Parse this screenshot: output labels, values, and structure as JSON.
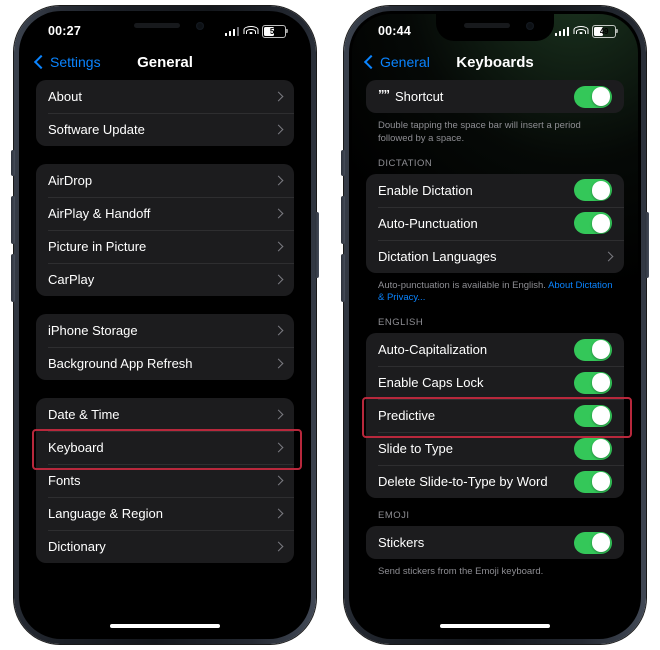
{
  "phones": [
    {
      "id": "left",
      "status": {
        "time": "00:27",
        "battery": "50",
        "wifi_icon": "wifi-icon",
        "cellular_icon": "cellular-signal-icon"
      },
      "nav": {
        "back_label": "Settings",
        "title": "General"
      },
      "groups": [
        {
          "rows": [
            {
              "label": "About",
              "type": "chevron"
            },
            {
              "label": "Software Update",
              "type": "chevron"
            }
          ]
        },
        {
          "rows": [
            {
              "label": "AirDrop",
              "type": "chevron"
            },
            {
              "label": "AirPlay & Handoff",
              "type": "chevron"
            },
            {
              "label": "Picture in Picture",
              "type": "chevron"
            },
            {
              "label": "CarPlay",
              "type": "chevron"
            }
          ]
        },
        {
          "rows": [
            {
              "label": "iPhone Storage",
              "type": "chevron"
            },
            {
              "label": "Background App Refresh",
              "type": "chevron"
            }
          ]
        },
        {
          "rows": [
            {
              "label": "Date & Time",
              "type": "chevron"
            },
            {
              "label": "Keyboard",
              "type": "chevron",
              "highlighted": true
            },
            {
              "label": "Fonts",
              "type": "chevron"
            },
            {
              "label": "Language & Region",
              "type": "chevron"
            },
            {
              "label": "Dictionary",
              "type": "chevron"
            }
          ]
        }
      ]
    },
    {
      "id": "right",
      "status": {
        "time": "00:44",
        "battery": "49",
        "wifi_icon": "wifi-icon",
        "cellular_icon": "cellular-signal-icon"
      },
      "nav": {
        "back_label": "General",
        "title": "Keyboards"
      },
      "groups": [
        {
          "rows": [
            {
              "label": "Shortcut",
              "type": "toggle",
              "toggle_on": true,
              "icon": "quote-shortcut-icon",
              "icon_glyph": "””"
            }
          ],
          "footnote": "Double tapping the space bar will insert a period followed by a space."
        },
        {
          "header": "DICTATION",
          "rows": [
            {
              "label": "Enable Dictation",
              "type": "toggle",
              "toggle_on": true
            },
            {
              "label": "Auto-Punctuation",
              "type": "toggle",
              "toggle_on": true
            },
            {
              "label": "Dictation Languages",
              "type": "chevron"
            }
          ],
          "footnote": "Auto-punctuation is available in English. ",
          "footnote_link": "About Dictation & Privacy..."
        },
        {
          "header": "ENGLISH",
          "rows": [
            {
              "label": "Auto-Capitalization",
              "type": "toggle",
              "toggle_on": true
            },
            {
              "label": "Enable Caps Lock",
              "type": "toggle",
              "toggle_on": true
            },
            {
              "label": "Predictive",
              "type": "toggle",
              "toggle_on": true,
              "highlighted": true
            },
            {
              "label": "Slide to Type",
              "type": "toggle",
              "toggle_on": true
            },
            {
              "label": "Delete Slide-to-Type by Word",
              "type": "toggle",
              "toggle_on": true
            }
          ]
        },
        {
          "header": "EMOJI",
          "rows": [
            {
              "label": "Stickers",
              "type": "toggle",
              "toggle_on": true
            }
          ],
          "footnote": "Send stickers from the Emoji keyboard."
        }
      ]
    }
  ],
  "colors": {
    "accent_blue": "#0a84ff",
    "toggle_green": "#34c759",
    "highlight_red": "#b8283c",
    "group_bg": "#1c1c1e",
    "secondary_text": "#8e8e93"
  }
}
